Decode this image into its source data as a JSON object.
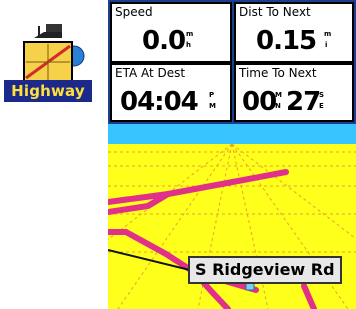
{
  "app": {
    "label": "Highway",
    "icon": "highway-map-icon"
  },
  "fields": [
    {
      "label": "Speed",
      "value": "0.0",
      "unit_top": "m",
      "unit_bottom": "h"
    },
    {
      "label": "Dist To Next",
      "value": "0.15",
      "unit_top": "m",
      "unit_bottom": "i"
    },
    {
      "label": "ETA At Dest",
      "value": "04:04",
      "unit_top": "P",
      "unit_bottom": "M"
    },
    {
      "label": "Time To Next",
      "value_a": "00",
      "unit_a_top": "M",
      "unit_a_bottom": "N",
      "value_b": "27",
      "unit_b_top": "S",
      "unit_b_bottom": "E"
    }
  ],
  "map": {
    "street_label": "S Ridgeview Rd",
    "position_icon": "triangle-pointer-icon",
    "colors": {
      "sky": "#37c4ff",
      "ground": "#ffff1c",
      "grid": "#e6a52a",
      "road": "#e0308a",
      "route": "#111111",
      "fields_bg": "#1a3f8f"
    }
  }
}
